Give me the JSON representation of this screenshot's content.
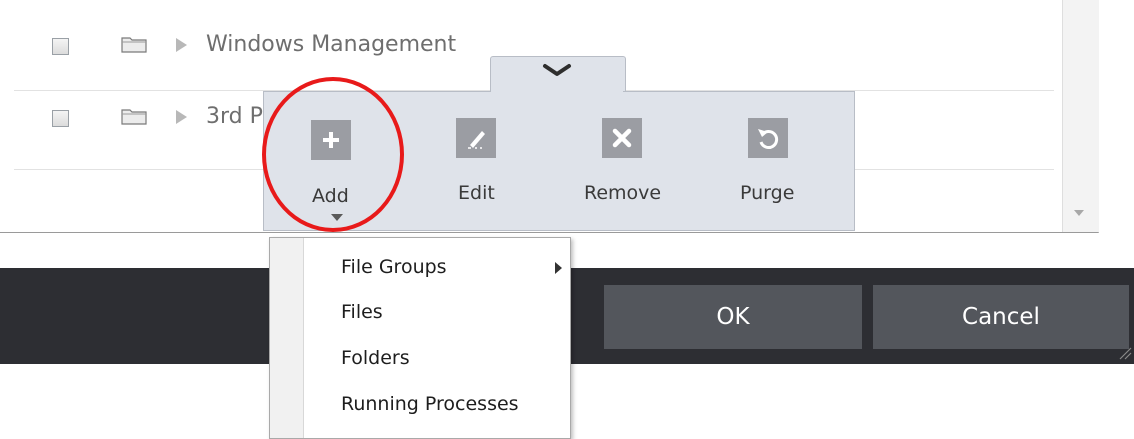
{
  "list": {
    "rows": [
      {
        "label": "Windows Management"
      },
      {
        "label": "3rd P"
      }
    ]
  },
  "toolbar": {
    "add_label": "Add",
    "edit_label": "Edit",
    "remove_label": "Remove",
    "purge_label": "Purge"
  },
  "add_menu": {
    "items": [
      {
        "label": "File Groups"
      },
      {
        "label": "Files"
      },
      {
        "label": "Folders"
      },
      {
        "label": "Running Processes"
      }
    ]
  },
  "dialog_buttons": {
    "ok_label": "OK",
    "cancel_label": "Cancel"
  },
  "colors": {
    "toolbar_bg": "#dfe3ea",
    "icon_bg": "#9b9da3",
    "dark_bar": "#2d2e33",
    "button_bg": "#53565c",
    "highlight_circle": "#e81a1a"
  },
  "icons": {
    "add": "plus-icon",
    "edit": "pencil-icon",
    "remove": "x-icon",
    "purge": "refresh-icon",
    "tab": "chevron-down-icon",
    "row": "folder-icon",
    "expand": "triangle-right-icon"
  }
}
